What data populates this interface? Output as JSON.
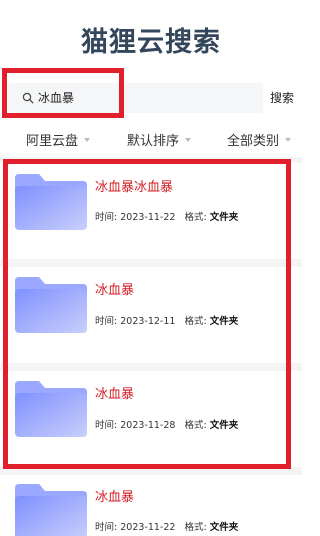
{
  "header": {
    "title": "猫狸云搜索"
  },
  "search": {
    "value": "冰血暴",
    "button_label": "搜索"
  },
  "filters": [
    {
      "label": "阿里云盘"
    },
    {
      "label": "默认排序"
    },
    {
      "label": "全部类别"
    }
  ],
  "results": [
    {
      "name": "冰血暴冰血暴",
      "time_label": "时间:",
      "time": "2023-11-22",
      "format_label": "格式:",
      "format": "文件夹"
    },
    {
      "name": "冰血暴",
      "time_label": "时间:",
      "time": "2023-12-11",
      "format_label": "格式:",
      "format": "文件夹"
    },
    {
      "name": "冰血暴",
      "time_label": "时间:",
      "time": "2023-11-28",
      "format_label": "格式:",
      "format": "文件夹"
    },
    {
      "name": "冰血暴",
      "time_label": "时间:",
      "time": "2023-11-22",
      "format_label": "格式:",
      "format": "文件夹"
    }
  ],
  "colors": {
    "accent_red": "#d42027",
    "highlight_border": "#e0202a",
    "title": "#33465c",
    "folder_blue": "#8a9cff"
  },
  "icons": {
    "search": "search-icon",
    "folder": "folder-icon",
    "dropdown": "chevron-down-icon"
  }
}
